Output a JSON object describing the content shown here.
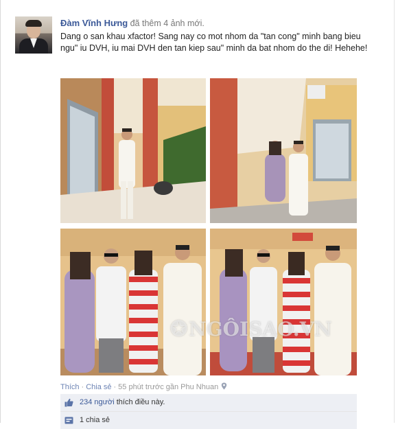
{
  "post": {
    "author": "Đàm Vĩnh Hưng",
    "action": "đã thêm 4 ảnh mới.",
    "status": "Dang o san khau xfactor! Sang nay co mot nhom da \"tan cong\" minh bang bieu ngu\" iu DVH, iu mai DVH den tan kiep sau\" minh da bat nhom do the di! Hehehe!",
    "photos": [
      {
        "scene": "corridor-single"
      },
      {
        "scene": "corridor-pair"
      },
      {
        "scene": "group-stage-1"
      },
      {
        "scene": "group-stage-2"
      }
    ],
    "watermark": "NGÔISAO.VN"
  },
  "meta": {
    "like_link": "Thích",
    "share_link": "Chia sẻ",
    "time": "55 phút trước gần Phu Nhuan",
    "location_icon": "map-pin-icon"
  },
  "ufi": {
    "likes_count": "234 người",
    "likes_suffix": " thích điều này.",
    "like_icon": "thumbs-up-icon",
    "shares": "1 chia sẻ",
    "share_icon": "share-icon"
  },
  "colors": {
    "link": "#3b5998",
    "meta": "#6d84b4",
    "ufi_bg": "#edeff4"
  }
}
